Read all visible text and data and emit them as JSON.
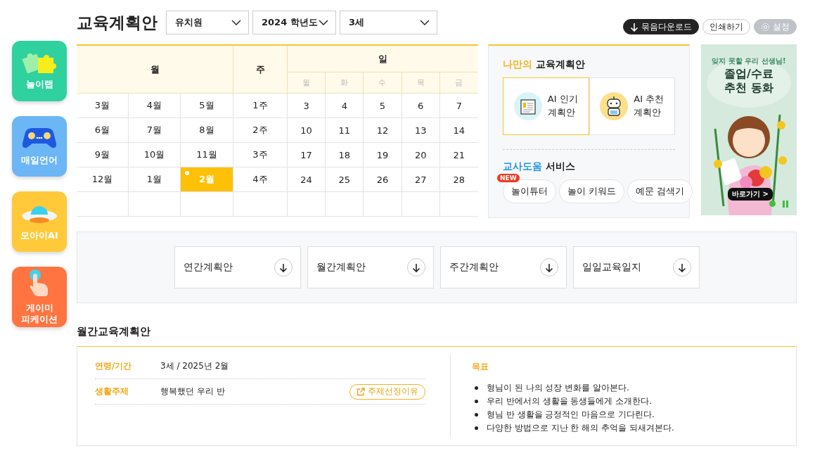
{
  "sidebar": {
    "items": [
      {
        "label": "놀이랩",
        "kind": "puzzle",
        "color": "#2fd19e"
      },
      {
        "label": "매일언어",
        "kind": "gamepad",
        "color": "#6cb6f6"
      },
      {
        "label": "모아이AI",
        "kind": "ufo",
        "color": "#ffc93a"
      },
      {
        "label": "게이미\n피케이션",
        "kind": "hand",
        "color": "#ff7440"
      }
    ]
  },
  "header": {
    "title": "교육계획안",
    "dropdowns": [
      "유치원",
      "2024 학년도",
      "3세"
    ],
    "buttons": [
      {
        "label": "묶음다운로드",
        "kind": "download"
      },
      {
        "label": "인쇄하기",
        "kind": "outline"
      },
      {
        "label": "설정",
        "kind": "settings"
      }
    ]
  },
  "calendar": {
    "month_header": "월",
    "week_header": "주",
    "day_header": "일",
    "weekdays": [
      "월",
      "화",
      "수",
      "목",
      "금"
    ],
    "months": [
      {
        "label": "3월",
        "selected": false
      },
      {
        "label": "4월",
        "selected": false
      },
      {
        "label": "5월",
        "selected": false
      },
      {
        "label": "6월",
        "selected": false
      },
      {
        "label": "7월",
        "selected": false
      },
      {
        "label": "8월",
        "selected": false
      },
      {
        "label": "9월",
        "selected": false
      },
      {
        "label": "10월",
        "selected": false
      },
      {
        "label": "11월",
        "selected": false
      },
      {
        "label": "12월",
        "selected": false
      },
      {
        "label": "1월",
        "selected": false
      },
      {
        "label": "2월",
        "selected": true
      }
    ],
    "weeks": [
      "1주",
      "2주",
      "3주",
      "4주"
    ],
    "days": [
      [
        "3",
        "4",
        "5",
        "6",
        "7"
      ],
      [
        "10",
        "11",
        "12",
        "13",
        "14"
      ],
      [
        "17",
        "18",
        "19",
        "20",
        "21"
      ],
      [
        "24",
        "25",
        "26",
        "27",
        "28"
      ]
    ]
  },
  "my_plan": {
    "title_highlight": "나만의",
    "title_rest": "교육계획안",
    "cards": [
      {
        "label": "AI 인기\n계획안",
        "kind": "document",
        "selected": true
      },
      {
        "label": "AI 추천\n계획안",
        "kind": "robot",
        "selected": false
      }
    ],
    "services_highlight": "교사도움",
    "services_rest": "서비스",
    "services": [
      {
        "label": "놀이튜터",
        "badge": "NEW"
      },
      {
        "label": "놀이 키워드"
      },
      {
        "label": "예문 검색기"
      }
    ]
  },
  "banner": {
    "tagline": "잊지 못할 우리 선생님!",
    "title": "졸업/수료\n추천 동화",
    "link": "바로가기 >"
  },
  "downloads": [
    "연간계획안",
    "월간계획안",
    "주간계획안",
    "일일교육일지"
  ],
  "monthly_plan": {
    "title": "월간교육계획안",
    "fields": [
      {
        "label": "연령/기간",
        "value": "3세 / 2025년 2월"
      },
      {
        "label": "생활주제",
        "value": "행복했던 우리 반",
        "button": "주제선정이유"
      }
    ],
    "goals_title": "목표",
    "goals": [
      "형님이 된 나의 성장 변화를 알아본다.",
      "우리 반에서의 생활을 동생들에게 소개한다.",
      "형님 반 생활을 긍정적인 마음으로 기다린다.",
      "다양한 방법으로 지난 한 해의 추억을 되새겨본다."
    ]
  }
}
